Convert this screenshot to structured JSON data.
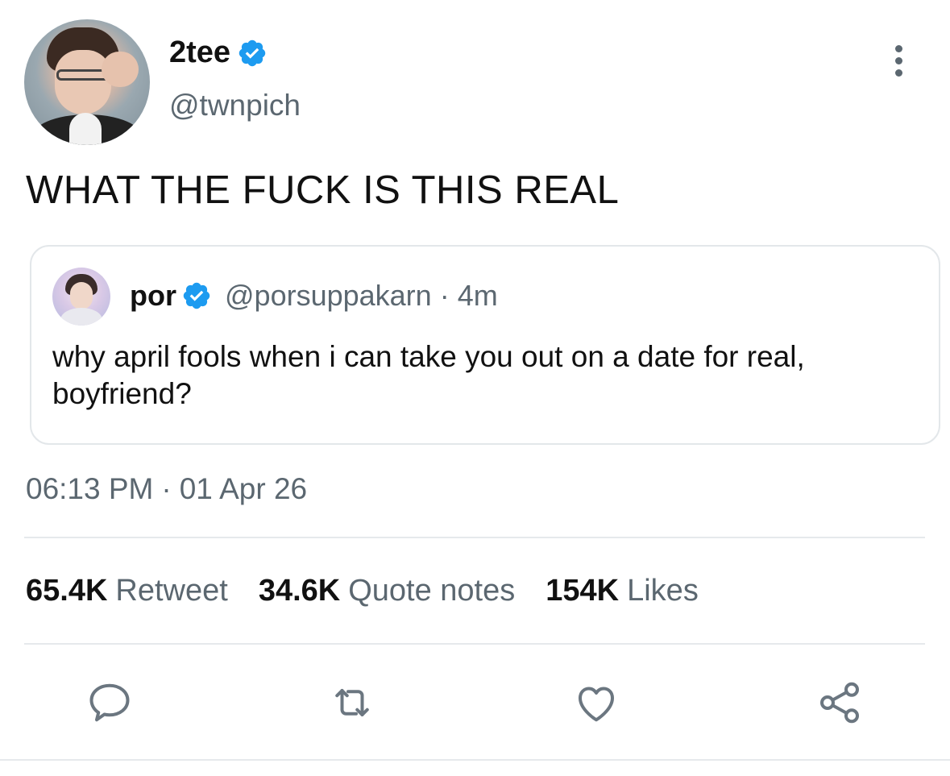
{
  "author": {
    "display_name": "2tee",
    "handle": "@twnpich"
  },
  "tweet": {
    "text": "WHAT THE FUCK IS THIS REAL",
    "time": "06:13 PM",
    "separator": "·",
    "date": "01 Apr 26"
  },
  "quoted": {
    "display_name": "por",
    "handle": "@porsuppakarn",
    "separator": "·",
    "time": "4m",
    "text": "why april fools when i can take you out on a date for real, boyfriend?"
  },
  "stats": {
    "retweets_count": "65.4K",
    "retweets_label": "Retweet",
    "quotes_count": "34.6K",
    "quotes_label": "Quote notes",
    "likes_count": "154K",
    "likes_label": "Likes"
  },
  "icons": {
    "verified": "verified-badge-icon",
    "more": "more-vertical-icon",
    "reply": "reply-icon",
    "retweet": "retweet-icon",
    "like": "heart-icon",
    "share": "share-icon"
  },
  "colors": {
    "verified_blue": "#1d9bf0",
    "secondary_text": "#5b6770",
    "icon_gray": "#6b7680"
  }
}
